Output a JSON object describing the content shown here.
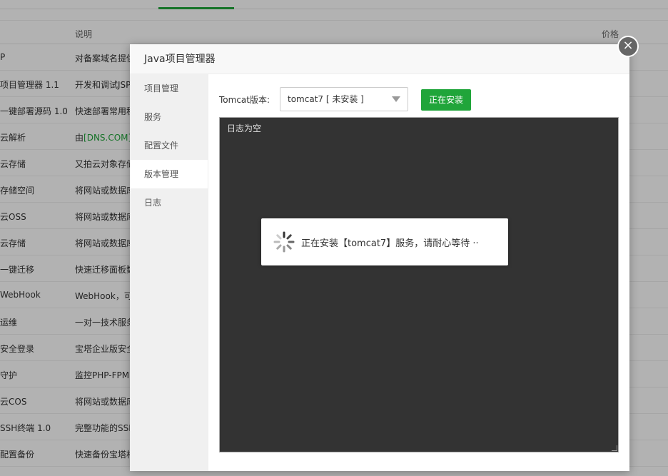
{
  "background": {
    "header": {
      "description_label": "说明",
      "price_label": "价格"
    },
    "rows": [
      {
        "name": "P",
        "desc": "对备案域名提供",
        "desc_highlight": ""
      },
      {
        "name": "项目管理器 1.1",
        "desc": "开发和调试JSP",
        "desc_highlight": ""
      },
      {
        "name": "一键部署源码 1.0",
        "desc": "快速部署常用程",
        "desc_highlight": ""
      },
      {
        "name": "云解析",
        "desc": "由",
        "desc_highlight": "[DNS.COM]"
      },
      {
        "name": "云存储",
        "desc": "又拍云对象存储",
        "desc_highlight": ""
      },
      {
        "name": "存储空间",
        "desc": "将网站或数据库",
        "desc_highlight": ""
      },
      {
        "name": "云OSS",
        "desc": "将网站或数据库",
        "desc_highlight": ""
      },
      {
        "name": "云存储",
        "desc": "将网站或数据库",
        "desc_highlight": ""
      },
      {
        "name": "一键迁移",
        "desc": "快速迁移面板数",
        "desc_highlight": ""
      },
      {
        "name": "WebHook",
        "desc": "WebHook，可",
        "desc_highlight": ""
      },
      {
        "name": "运维",
        "desc": "一对一技术服务",
        "desc_highlight": ""
      },
      {
        "name": "安全登录",
        "desc": "宝塔企业版安全",
        "desc_highlight": ""
      },
      {
        "name": "守护",
        "desc": "监控PHP-FPM",
        "desc_highlight": ""
      },
      {
        "name": "云COS",
        "desc": "将网站或数据库",
        "desc_highlight": ""
      },
      {
        "name": "SSH终端 1.0",
        "desc": "完整功能的SSH",
        "desc_highlight": ""
      },
      {
        "name": "配置备份",
        "desc": "快速备份宝塔相",
        "desc_highlight": ""
      }
    ]
  },
  "dialog": {
    "title": "Java项目管理器",
    "close_icon": "close-icon",
    "sidebar": [
      {
        "label": "项目管理",
        "active": false
      },
      {
        "label": "服务",
        "active": false
      },
      {
        "label": "配置文件",
        "active": false
      },
      {
        "label": "版本管理",
        "active": true
      },
      {
        "label": "日志",
        "active": false
      }
    ],
    "version": {
      "label": "Tomcat版本:",
      "selected": "tomcat7 [ 未安装 ]",
      "install_button": "正在安装"
    },
    "log": {
      "text": "日志为空"
    }
  },
  "loading": {
    "message": "正在安装【tomcat7】服务，请耐心等待 ··",
    "icon": "spinner-icon"
  },
  "colors": {
    "accent": "#20a53a",
    "log_bg": "#333333"
  }
}
